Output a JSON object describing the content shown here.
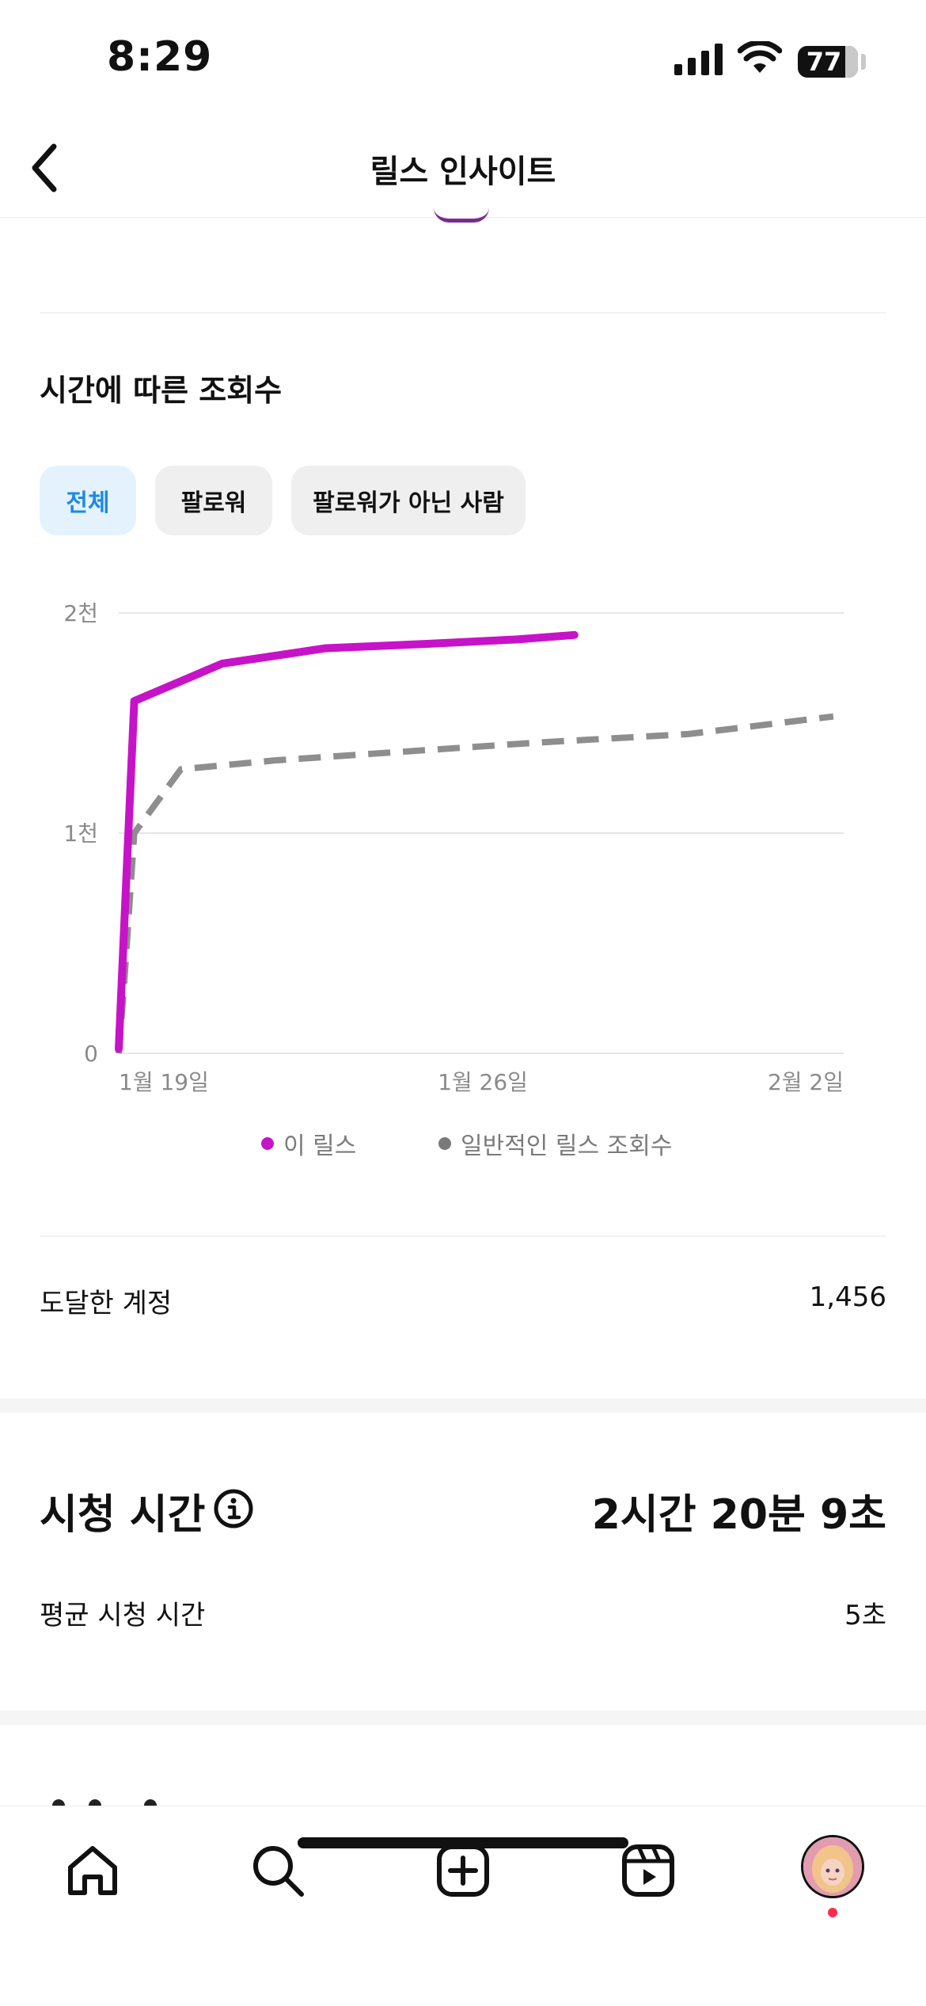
{
  "status_bar": {
    "time": "8:29",
    "battery": "77",
    "icons": [
      "signal-icon",
      "wifi-icon",
      "battery-icon"
    ]
  },
  "header": {
    "title": "릴스 인사이트",
    "back_icon": "chevron-left-icon"
  },
  "views_section": {
    "title": "시간에 따른 조회수",
    "filters": [
      {
        "label": "전체",
        "active": true
      },
      {
        "label": "팔로워",
        "active": false
      },
      {
        "label": "팔로워가 아닌 사람",
        "active": false
      }
    ]
  },
  "chart_data": {
    "type": "line",
    "y_ticks": [
      "2천",
      "1천",
      "0"
    ],
    "x_ticks": [
      "1월 19일",
      "1월 26일",
      "2월 2일"
    ],
    "ylim": [
      0,
      2000
    ],
    "xlim": [
      "1월 19일",
      "2월 2일"
    ],
    "x_unit": "days since 1월 19일",
    "grid": true,
    "legend_position": "bottom",
    "series": [
      {
        "name": "이 릴스",
        "color": "#c713c8",
        "style": "solid",
        "x": [
          0,
          0.3,
          2,
          4,
          6,
          7.7,
          8.8
        ],
        "values": [
          20,
          1600,
          1770,
          1840,
          1860,
          1880,
          1900
        ]
      },
      {
        "name": "일반적인 릴스 조회수",
        "color": "#8e8e8e",
        "style": "dashed",
        "x": [
          0,
          0.1,
          0.3,
          1.2,
          3,
          8,
          11,
          13.8
        ],
        "values": [
          0,
          300,
          1000,
          1290,
          1330,
          1410,
          1450,
          1530
        ]
      }
    ]
  },
  "reach": {
    "label": "도달한 계정",
    "value": "1,456"
  },
  "watch_time": {
    "title": "시청 시간",
    "info_icon": "info-icon",
    "value": "2시간 20분 9초",
    "avg_label": "평균 시청 시간",
    "avg_value": "5초"
  },
  "tab_bar": {
    "items": [
      "home-icon",
      "search-icon",
      "create-icon",
      "reels-icon",
      "profile-avatar"
    ]
  },
  "colors": {
    "accent": "#1e88e5",
    "chip_active_bg": "#e3f2fd",
    "this_reel": "#c713c8",
    "typical": "#8e8e8e"
  }
}
